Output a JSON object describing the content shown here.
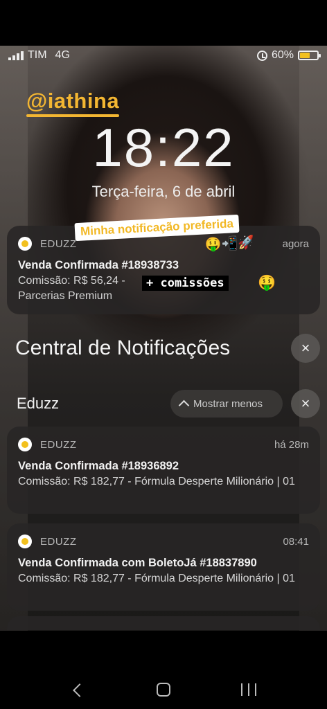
{
  "status_bar": {
    "carrier": "TIM",
    "network": "4G",
    "battery": "60%",
    "battery_level": 0.6,
    "battery_color": "#f2c01e"
  },
  "overlay": {
    "handle": "@iathina",
    "sticker": "Minha notificação preferida",
    "emojis": "🤑📲🚀",
    "commission_tag": "+ comissões",
    "money_face": "🤑"
  },
  "lockscreen": {
    "time": "18:22",
    "date": "Terça-feira, 6 de abril"
  },
  "pinned_notification": {
    "app": "EDUZZ",
    "time": "agora",
    "title": "Venda Confirmada #18938733",
    "body_line1": "Comissão: R$ 56,24 -",
    "body_line2": "Parcerias Premium"
  },
  "notification_center": {
    "title": "Central de Notificações",
    "close_icon": "×",
    "group": {
      "name": "Eduzz",
      "toggle_label": "Mostrar menos"
    },
    "items": [
      {
        "app": "EDUZZ",
        "time": "há 28m",
        "title": "Venda Confirmada #18936892",
        "body": "Comissão: R$ 182,77 - Fórmula Desperte Milionário | 01"
      },
      {
        "app": "EDUZZ",
        "time": "08:41",
        "title": "Venda Confirmada com BoletoJá #18837890",
        "body": "Comissão: R$ 182,77 - Fórmula Desperte Milionário | 01"
      }
    ]
  }
}
